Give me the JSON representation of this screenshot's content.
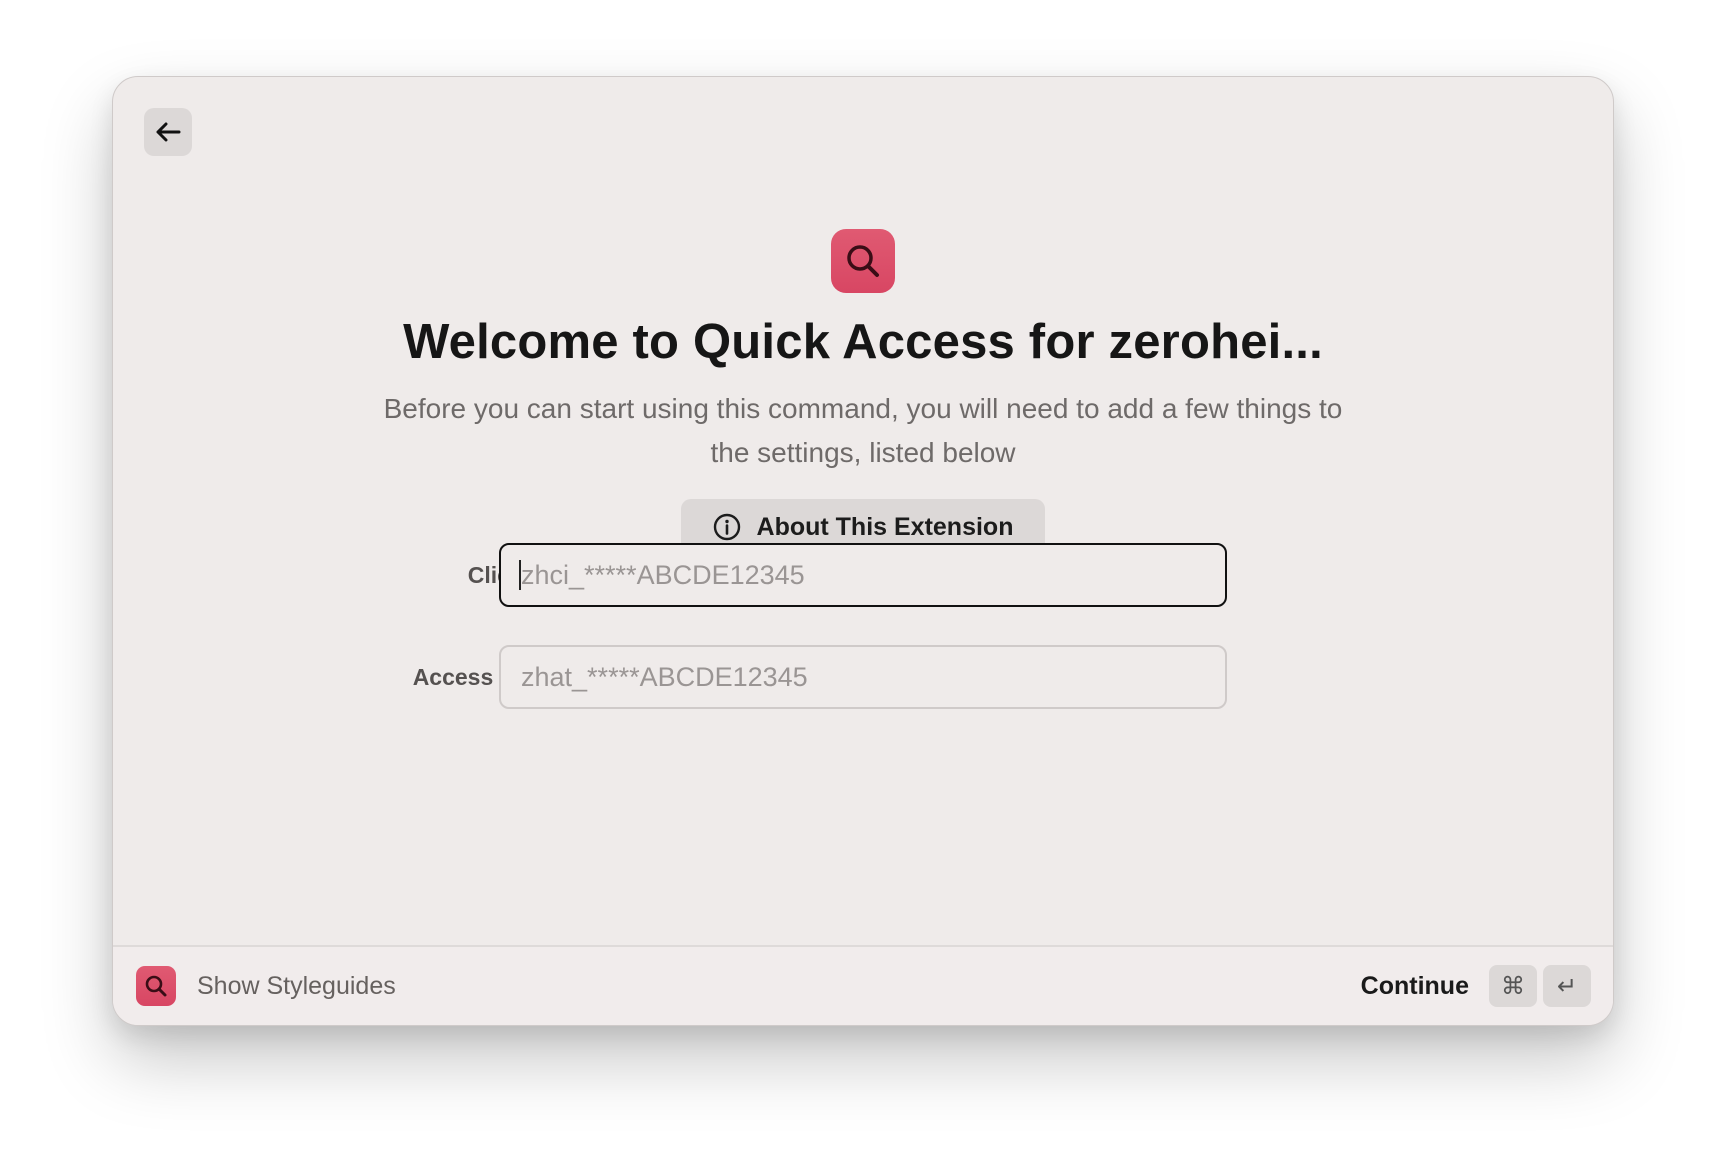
{
  "window": {
    "back_icon": "arrow-left-icon"
  },
  "hero": {
    "icon": "magnifying-glass-icon",
    "accent_color": "#dc4f6a",
    "title": "Welcome to Quick Access for zerohei...",
    "subtitle": "Before you can start using this command, you will need to add a few things to the settings, listed below",
    "about_button": {
      "icon": "info-circle-icon",
      "label": "About This Extension"
    }
  },
  "form": {
    "fields": [
      {
        "label": "Client ID",
        "value": "",
        "placeholder": "zhci_*****ABCDE12345",
        "focused": true
      },
      {
        "label": "Access token",
        "value": "",
        "placeholder": "zhat_*****ABCDE12345",
        "focused": false
      }
    ]
  },
  "footer": {
    "icon": "magnifying-glass-icon",
    "command_label": "Show Styleguides",
    "action_label": "Continue",
    "shortcut_keys": [
      "⌘",
      "↵"
    ]
  }
}
